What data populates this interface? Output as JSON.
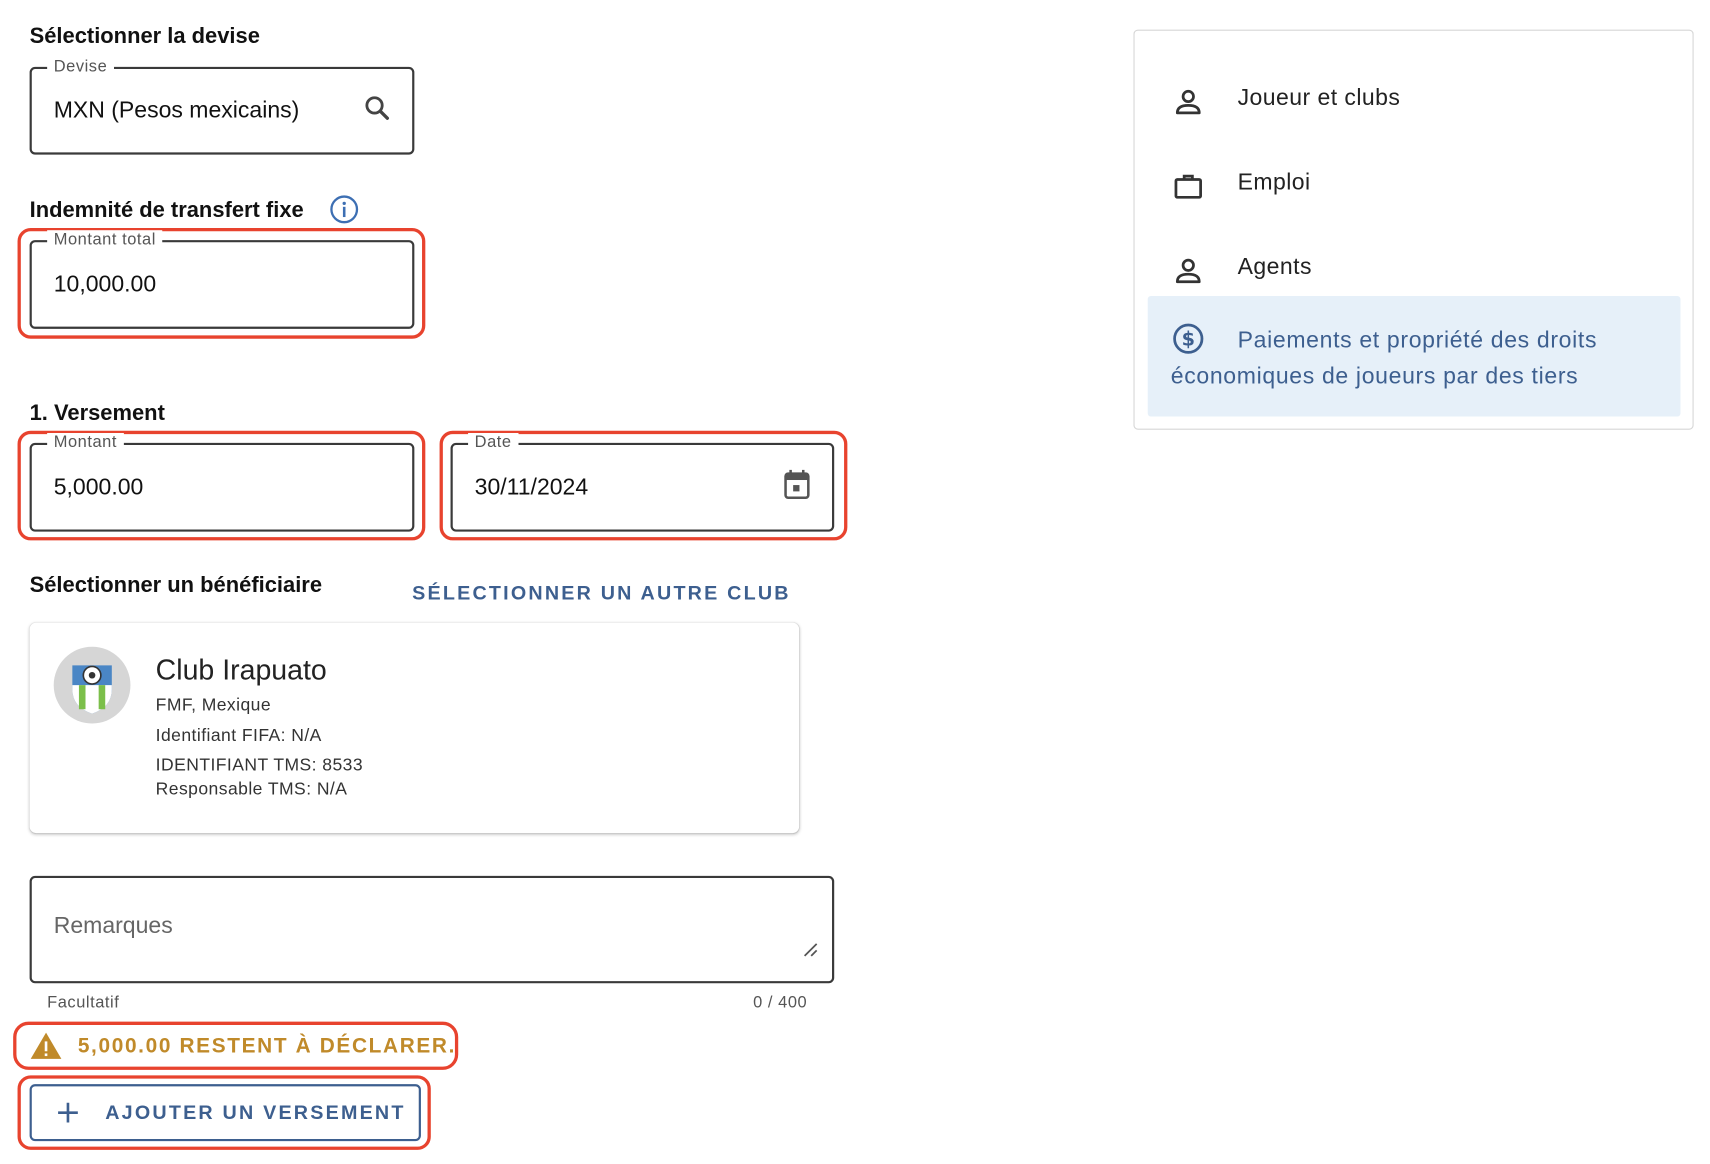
{
  "currency_section": {
    "title": "Sélectionner la devise",
    "legend": "Devise",
    "value": "MXN (Pesos mexicains)",
    "icon": "search-icon"
  },
  "fixed_fee_section": {
    "title": "Indemnité de transfert fixe",
    "info_icon": "info-icon",
    "legend": "Montant total",
    "value": "10,000.00"
  },
  "installment": {
    "title": "1. Versement",
    "amount_legend": "Montant",
    "amount_value": "5,000.00",
    "date_legend": "Date",
    "date_value": "30/11/2024",
    "date_icon": "calendar-icon"
  },
  "beneficiary": {
    "title": "Sélectionner un bénéficiaire",
    "select_other_label": "SÉLECTIONNER UN AUTRE CLUB",
    "club": {
      "name": "Club Irapuato",
      "association": "FMF, Mexique",
      "fifa_id": "Identifiant FIFA: N/A",
      "tms_id": "IDENTIFIANT TMS: 8533",
      "tms_manager": "Responsable TMS: N/A"
    }
  },
  "remarks": {
    "placeholder": "Remarques",
    "helper": "Facultatif",
    "counter": "0 / 400"
  },
  "warning": {
    "text": "5,000.00 RESTENT À DÉCLARER.",
    "color": "#c08a2a"
  },
  "add_button": {
    "label": "AJOUTER UN VERSEMENT"
  },
  "nav": {
    "items": [
      {
        "label": "Joueur et clubs",
        "icon": "person-icon"
      },
      {
        "label": "Emploi",
        "icon": "briefcase-icon"
      },
      {
        "label": "Agents",
        "icon": "person-icon"
      },
      {
        "label": "Paiements et propriété des droits économiques de joueurs par des tiers",
        "icon": "dollar-circle-icon",
        "active": true
      }
    ]
  },
  "colors": {
    "accent": "#3d5f8f",
    "highlight": "#e8432e",
    "active_bg": "#e6f0f9"
  }
}
